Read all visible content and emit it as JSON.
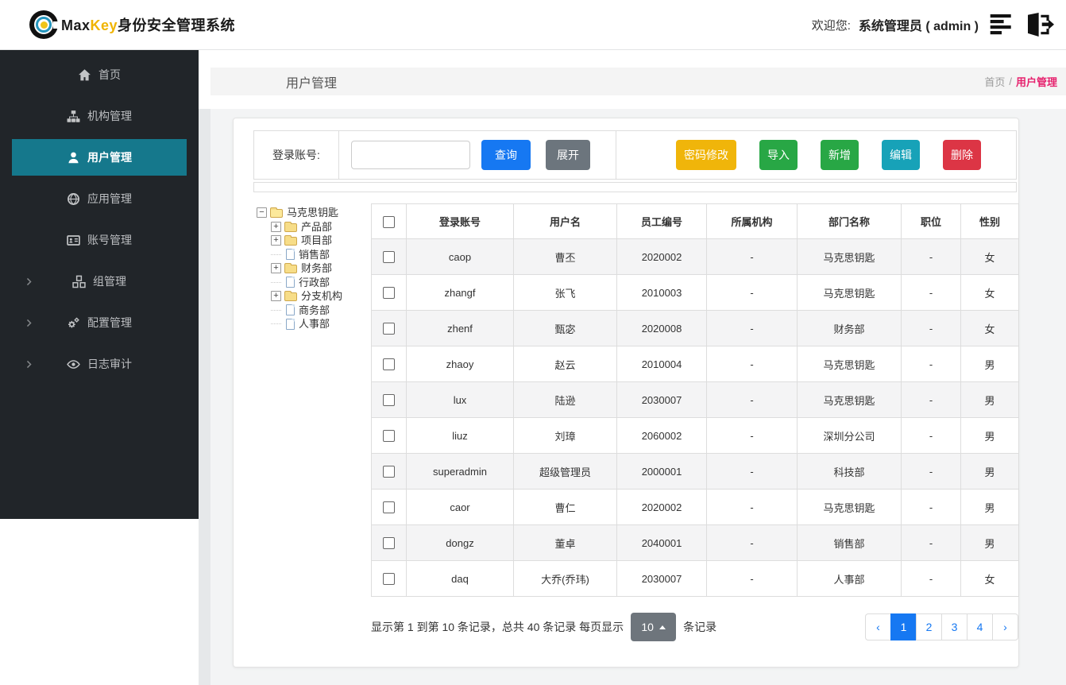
{
  "header": {
    "logo_black": "Max",
    "logo_gold": "Key",
    "logo_cn": "身份安全管理系统",
    "welcome_label": "欢迎您:",
    "welcome_user": "系统管理员 ( admin )"
  },
  "sidebar": {
    "items": [
      {
        "id": "home",
        "label": "首页",
        "icon": "home",
        "active": false,
        "expandable": false
      },
      {
        "id": "org",
        "label": "机构管理",
        "icon": "sitemap",
        "active": false,
        "expandable": false
      },
      {
        "id": "user",
        "label": "用户管理",
        "icon": "user",
        "active": true,
        "expandable": false
      },
      {
        "id": "app",
        "label": "应用管理",
        "icon": "globe",
        "active": false,
        "expandable": false
      },
      {
        "id": "account",
        "label": "账号管理",
        "icon": "id-card",
        "active": false,
        "expandable": false
      },
      {
        "id": "group",
        "label": "组管理",
        "icon": "cubes",
        "active": false,
        "expandable": true
      },
      {
        "id": "config",
        "label": "配置管理",
        "icon": "gears",
        "active": false,
        "expandable": true
      },
      {
        "id": "audit",
        "label": "日志审计",
        "icon": "eye",
        "active": false,
        "expandable": true
      }
    ]
  },
  "page": {
    "title": "用户管理",
    "breadcrumb_home": "首页",
    "breadcrumb_sep": "/",
    "breadcrumb_current": "用户管理"
  },
  "toolbar": {
    "search_label": "登录账号:",
    "search_value": "",
    "query_label": "查询",
    "expand_label": "展开",
    "actions": [
      {
        "id": "password",
        "label": "密码修改",
        "color": "#f0b50a"
      },
      {
        "id": "import",
        "label": "导入",
        "color": "#28a745"
      },
      {
        "id": "add",
        "label": "新增",
        "color": "#28a745"
      },
      {
        "id": "edit",
        "label": "编辑",
        "color": "#17a2b8"
      },
      {
        "id": "delete",
        "label": "删除",
        "color": "#dc3545"
      }
    ]
  },
  "tree": {
    "root": {
      "id": "maxkey-root",
      "label": "马克思钥匙",
      "expanded": true
    },
    "children": [
      {
        "id": "product",
        "label": "产品部",
        "type": "folder",
        "expandable": true
      },
      {
        "id": "project",
        "label": "项目部",
        "type": "folder",
        "expandable": true
      },
      {
        "id": "sales",
        "label": "销售部",
        "type": "file",
        "expandable": false
      },
      {
        "id": "finance",
        "label": "财务部",
        "type": "folder",
        "expandable": true
      },
      {
        "id": "admin",
        "label": "行政部",
        "type": "file",
        "expandable": false
      },
      {
        "id": "branch",
        "label": "分支机构",
        "type": "folder",
        "expandable": true
      },
      {
        "id": "business",
        "label": "商务部",
        "type": "file",
        "expandable": false
      },
      {
        "id": "hr",
        "label": "人事部",
        "type": "file",
        "expandable": false
      }
    ]
  },
  "table": {
    "columns": [
      {
        "id": "login",
        "label": "登录账号"
      },
      {
        "id": "username",
        "label": "用户名"
      },
      {
        "id": "emp_no",
        "label": "员工编号"
      },
      {
        "id": "org",
        "label": "所属机构"
      },
      {
        "id": "dept",
        "label": "部门名称"
      },
      {
        "id": "position",
        "label": "职位"
      },
      {
        "id": "gender",
        "label": "性别"
      }
    ],
    "rows": [
      [
        "caop",
        "曹丕",
        "2020002",
        "-",
        "马克思钥匙",
        "-",
        "女"
      ],
      [
        "zhangf",
        "张飞",
        "2010003",
        "-",
        "马克思钥匙",
        "-",
        "女"
      ],
      [
        "zhenf",
        "甄宓",
        "2020008",
        "-",
        "财务部",
        "-",
        "女"
      ],
      [
        "zhaoy",
        "赵云",
        "2010004",
        "-",
        "马克思钥匙",
        "-",
        "男"
      ],
      [
        "lux",
        "陆逊",
        "2030007",
        "-",
        "马克思钥匙",
        "-",
        "男"
      ],
      [
        "liuz",
        "刘璋",
        "2060002",
        "-",
        "深圳分公司",
        "-",
        "男"
      ],
      [
        "superadmin",
        "超级管理员",
        "2000001",
        "-",
        "科技部",
        "-",
        "男"
      ],
      [
        "caor",
        "曹仁",
        "2020002",
        "-",
        "马克思钥匙",
        "-",
        "男"
      ],
      [
        "dongz",
        "董卓",
        "2040001",
        "-",
        "销售部",
        "-",
        "男"
      ],
      [
        "daq",
        "大乔(乔玮)",
        "2030007",
        "-",
        "人事部",
        "-",
        "女"
      ]
    ]
  },
  "pagination": {
    "info_prefix": "显示第 1 到第 10 条记录，总共 40 条记录 每页显示",
    "page_size": "10",
    "info_suffix": "条记录",
    "prev": "‹",
    "next": "›",
    "pages": [
      "1",
      "2",
      "3",
      "4"
    ],
    "active_page": "1"
  },
  "colors": {
    "accent_blue": "#1678f2",
    "sidebar_active": "#15788c",
    "breadcrumb_current": "#e6226e"
  }
}
